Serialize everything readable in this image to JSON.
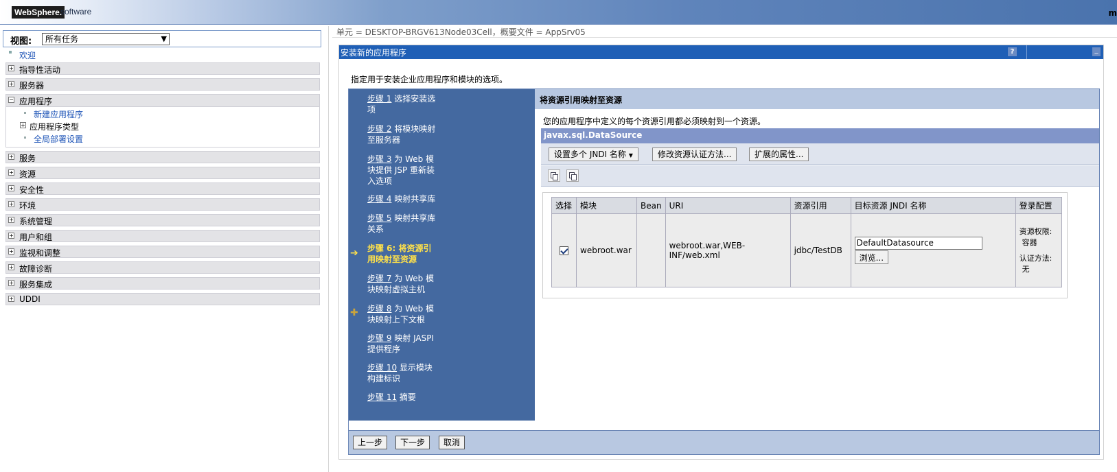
{
  "header": {
    "logo": "WebSphere.",
    "logo_suffix": "software",
    "right_text": "m"
  },
  "nav": {
    "view_label": "视图:",
    "view_value": "所有任务",
    "welcome": "欢迎",
    "items_top": [
      "指导性活动",
      "服务器"
    ],
    "app_group": {
      "label": "应用程序",
      "children": {
        "new_app": "新建应用程序",
        "app_types": "应用程序类型",
        "global_deploy": "全局部署设置"
      }
    },
    "items_bottom": [
      "服务",
      "资源",
      "安全性",
      "环境",
      "系统管理",
      "用户和组",
      "监视和调整",
      "故障诊断",
      "服务集成",
      "UDDI"
    ]
  },
  "main": {
    "breadcrumb": "单元 = DESKTOP-BRGV613Node03Cell，概要文件 = AppSrv05",
    "panel_title": "安装新的应用程序",
    "help": "?",
    "minimize": "_",
    "description": "指定用于安装企业应用程序和模块的选项。"
  },
  "steps": [
    {
      "num": "步骤 1",
      "text": " 选择安装选",
      "text2": "项"
    },
    {
      "num": "步骤 2",
      "text": " 将模块映射",
      "text2": "至服务器"
    },
    {
      "num": "步骤 3",
      "text": " 为 Web 模",
      "text2": "块提供 JSP 重新装",
      "text3": "入选项"
    },
    {
      "num": "步骤 4",
      "text": " 映射共享库"
    },
    {
      "num": "步骤 5",
      "text": " 映射共享库",
      "text2": "关系"
    },
    {
      "num": "步骤 6: 将资源引",
      "text2": "用映射至资源"
    },
    {
      "num": "步骤 7",
      "text": " 为 Web 模",
      "text2": "块映射虚拟主机"
    },
    {
      "num": "步骤 8",
      "text": " 为 Web 模",
      "text2": "块映射上下文根"
    },
    {
      "num": "步骤 9",
      "text": " 映射 JASPI",
      "text2": "提供程序"
    },
    {
      "num": "步骤 10",
      "text": " 显示模块",
      "text2": "构建标识"
    },
    {
      "num": "步骤 11",
      "text": " 摘要"
    }
  ],
  "content": {
    "title": "将资源引用映射至资源",
    "description": "您的应用程序中定义的每个资源引用都必须映射到一个资源。",
    "datasource": "javax.sql.DataSource",
    "buttons": {
      "set_jndi": "设置多个 JNDI 名称",
      "modify_auth": "修改资源认证方法...",
      "ext_props": "扩展的属性..."
    },
    "table": {
      "headers": [
        "选择",
        "模块",
        "Bean",
        "URI",
        "资源引用",
        "目标资源 JNDI 名称",
        "登录配置"
      ],
      "row": {
        "module": "webroot.war",
        "bean": "",
        "uri": "webroot.war,WEB-INF/web.xml",
        "resource_ref": "jdbc/TestDB",
        "jndi_value": "DefaultDatasource",
        "browse": "浏览...",
        "login_auth_label": "资源权限:",
        "login_auth_value": "容器",
        "login_method_label": "认证方法:",
        "login_method_value": "无"
      }
    }
  },
  "footer": {
    "prev": "上一步",
    "next": "下一步",
    "cancel": "取消"
  }
}
